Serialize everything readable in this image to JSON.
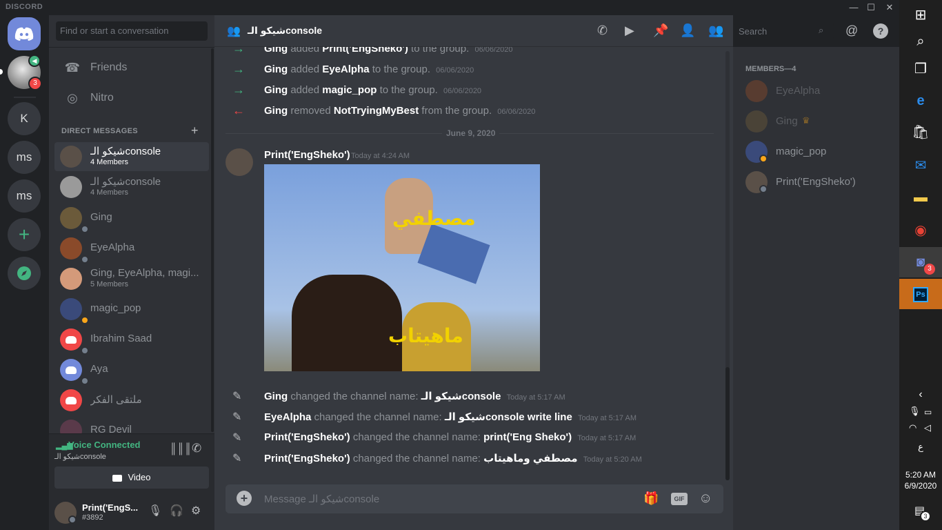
{
  "app": {
    "brand": "DISCORD"
  },
  "window": {
    "minimize": "—",
    "maximize": "☐",
    "close": "✕"
  },
  "servers": {
    "home_icon": "discord-logo-icon",
    "badge": "3",
    "items": [
      "K",
      "ms",
      "ms"
    ],
    "add": "+",
    "explore": "compass-icon"
  },
  "search": {
    "placeholder": "Find or start a conversation"
  },
  "nav": {
    "friends": "Friends",
    "nitro": "Nitro"
  },
  "dm_header": "DIRECT MESSAGES",
  "dm_add": "+",
  "dms": [
    {
      "name": "شيكو الـconsole",
      "sub": "4 Members"
    },
    {
      "name": "شيكو الـconsole",
      "sub": "4 Members"
    },
    {
      "name": "Ging"
    },
    {
      "name": "EyeAlpha"
    },
    {
      "name": "Ging, EyeAlpha, magi...",
      "sub": "5 Members"
    },
    {
      "name": "magic_pop"
    },
    {
      "name": "Ibrahim Saad"
    },
    {
      "name": "Aya"
    },
    {
      "name": "ملتقى الفكر"
    },
    {
      "name": "RG Devil"
    }
  ],
  "voice": {
    "status": "Voice Connected",
    "channel": "شيكو الـconsole",
    "video": "Video"
  },
  "user": {
    "name": "Print('EngS...",
    "tag": "#3892"
  },
  "chat": {
    "channel_name": "شيكو الـconsole",
    "system": [
      {
        "user": "Ging",
        "action": "added",
        "target": "Print('EngSheko')",
        "after": "to the group.",
        "ts": "06/06/2020"
      },
      {
        "user": "Ging",
        "action": "added",
        "target": "EyeAlpha",
        "after": "to the group.",
        "ts": "06/06/2020"
      },
      {
        "user": "Ging",
        "action": "added",
        "target": "magic_pop",
        "after": "to the group.",
        "ts": "06/06/2020"
      },
      {
        "user": "Ging",
        "action": "removed",
        "target": "NotTryingMyBest",
        "after": "from the group.",
        "ts": "06/06/2020"
      }
    ],
    "date_divider": "June 9, 2020",
    "message": {
      "author": "Print('EngSheko')",
      "ts": "Today at 4:24 AM",
      "image_text_top": "مصطفي",
      "image_text_bottom": "ماهيتاب"
    },
    "renames": [
      {
        "user": "Ging",
        "action": "changed the channel name:",
        "name": "شيكو الـconsole",
        "ts": "Today at 5:17 AM"
      },
      {
        "user": "EyeAlpha",
        "action": "changed the channel name:",
        "name": "شيكو الـconsole write line",
        "ts": "Today at 5:17 AM"
      },
      {
        "user": "Print('EngSheko')",
        "action": "changed the channel name:",
        "name": "print('Eng Sheko')",
        "ts": "Today at 5:17 AM"
      },
      {
        "user": "Print('EngSheko')",
        "action": "changed the channel name:",
        "name": "مصطفي وماهيتاب",
        "ts": "Today at 5:20 AM"
      }
    ],
    "composer_placeholder": "Message شيكو الـconsole",
    "gif": "GIF"
  },
  "header_search": {
    "placeholder": "Search"
  },
  "members": {
    "header": "MEMBERS—4",
    "list": [
      "EyeAlpha",
      "Ging",
      "magic_pop",
      "Print('EngSheko')"
    ]
  },
  "taskbar": {
    "time": "5:20 AM",
    "date": "6/9/2020",
    "lang": "ع",
    "notif": "3",
    "discord_badge": "3",
    "ps": "Ps"
  }
}
